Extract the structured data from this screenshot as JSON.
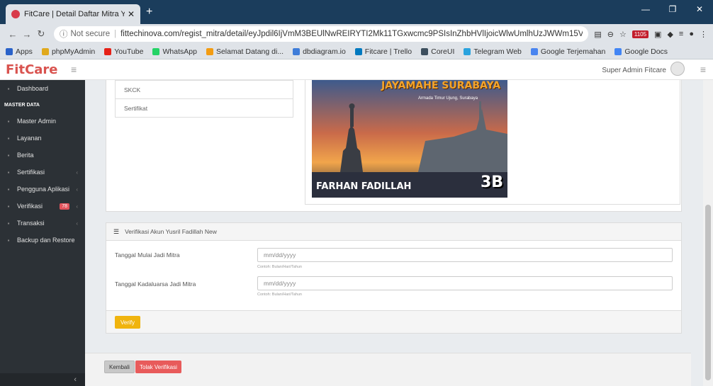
{
  "browser": {
    "tab_title": "FitCare | Detail Daftar Mitra Yusri",
    "not_secure": "Not secure",
    "url": "fittechinova.com/regist_mitra/detail/eyJpdil6IjVmM3BEUlNwREIRYTI2Mk11TGxwcmc9PSIsInZhbHVlIjoicWlwUmlhUzJWWm15VW9...",
    "ext_badge": "1105",
    "bookmarks": [
      {
        "label": "Apps",
        "color": "#2a62c9"
      },
      {
        "label": "phpMyAdmin",
        "color": "#e0a91d"
      },
      {
        "label": "YouTube",
        "color": "#e62117"
      },
      {
        "label": "WhatsApp",
        "color": "#25d366"
      },
      {
        "label": "Selamat Datang di...",
        "color": "#f39c12"
      },
      {
        "label": "dbdiagram.io",
        "color": "#3f7dd9"
      },
      {
        "label": "Fitcare | Trello",
        "color": "#0079bf"
      },
      {
        "label": "CoreUI",
        "color": "#3d4f5e"
      },
      {
        "label": "Telegram Web",
        "color": "#2aa3de"
      },
      {
        "label": "Google Terjemahan",
        "color": "#4a85f0"
      },
      {
        "label": "Google Docs",
        "color": "#4285f4"
      }
    ]
  },
  "app": {
    "logo": "FitCare",
    "admin_label": "Super Admin Fitcare"
  },
  "sidebar": {
    "items": [
      {
        "label": "Dashboard",
        "icon": "dashboard-icon"
      },
      {
        "label": "MASTER DATA",
        "header": true
      },
      {
        "label": "Master Admin",
        "icon": "user-icon"
      },
      {
        "label": "Layanan",
        "icon": "layanan-icon"
      },
      {
        "label": "Berita",
        "icon": "news-icon"
      },
      {
        "label": "Sertifikasi",
        "icon": "certificate-icon",
        "chev": true
      },
      {
        "label": "Pengguna Aplikasi",
        "icon": "users-icon",
        "chev": true
      },
      {
        "label": "Verifikasi",
        "icon": "verify-icon",
        "chev": true,
        "badge": "78"
      },
      {
        "label": "Transaksi",
        "icon": "transaction-icon",
        "chev": true
      },
      {
        "label": "Backup dan Restore",
        "icon": "backup-icon"
      }
    ]
  },
  "documents": {
    "items": [
      "SKCK",
      "Sertifikat"
    ]
  },
  "photo": {
    "top_text": "JAYAMAHE SURABAYA",
    "sub_text": "Armada Timur Ujung, Surabaya",
    "name_text": "FARHAN FADILLAH",
    "corner_text": "3B"
  },
  "verification": {
    "title": "Verifikasi Akun Yusril Fadillah New",
    "fields": [
      {
        "label": "Tanggal Mulai Jadi Mitra",
        "placeholder": "mm/dd/yyyy",
        "help": "Contoh: Bulan/Hari/Tahun"
      },
      {
        "label": "Tanggal Kadaluarsa Jadi Mitra",
        "placeholder": "mm/dd/yyyy",
        "help": "Contoh: Bulan/Hari/Tahun"
      }
    ],
    "verify_label": "Verify"
  },
  "actions": {
    "back_label": "Kembali",
    "reject_label": "Tolak Verifikasi"
  },
  "colors": {
    "accent": "#d9534f",
    "sidebar": "#2c3136",
    "verify": "#f0b40e",
    "reject": "#e85b5b"
  }
}
